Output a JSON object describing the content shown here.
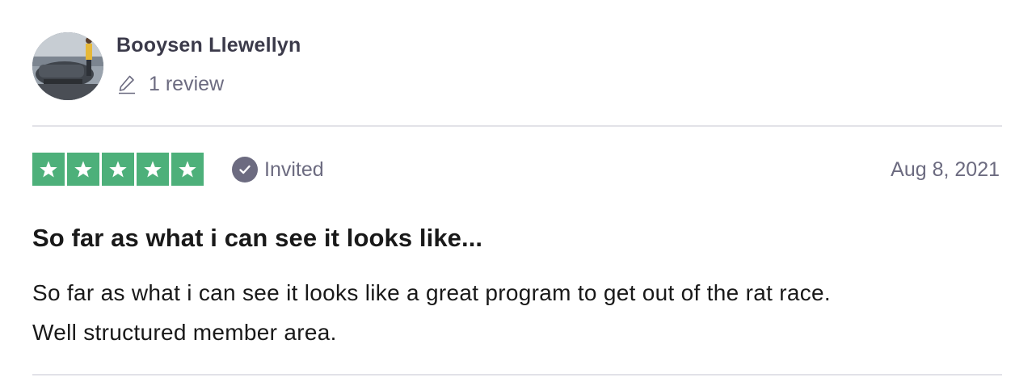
{
  "reviewer": {
    "name": "Booysen Llewellyn",
    "review_count": "1 review",
    "avatar_icon": "user-photo-avatar"
  },
  "review": {
    "rating": 5,
    "rating_max": 5,
    "star_color": "#4db07a",
    "verification_label": "Invited",
    "verification_icon": "check-circle-icon",
    "date": "Aug 8, 2021",
    "title": "So far as what i can see it looks like...",
    "body_lines": [
      "So far as what i can see it looks like a great program to get out of the rat race.",
      "Well structured member area."
    ]
  }
}
